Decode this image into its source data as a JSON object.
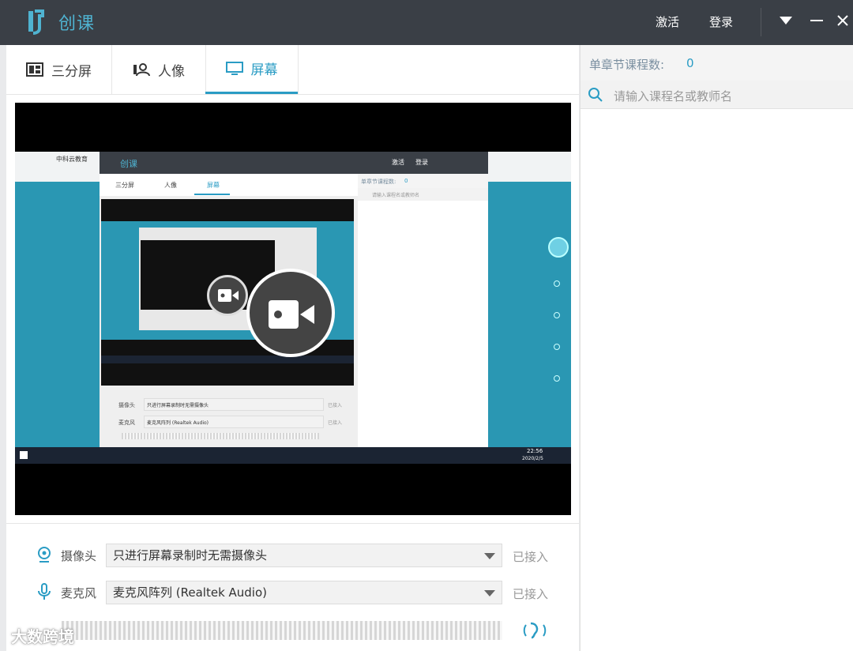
{
  "app": {
    "name": "创课"
  },
  "titlebar": {
    "activate": "激活",
    "login": "登录"
  },
  "tabs": [
    {
      "label": "三分屏",
      "icon": "layout-icon"
    },
    {
      "label": "人像",
      "icon": "portrait-icon"
    },
    {
      "label": "屏幕",
      "icon": "monitor-icon",
      "active": true
    }
  ],
  "devices": {
    "camera": {
      "label": "摄像头",
      "value": "只进行屏幕录制时无需摄像头",
      "status": "已接入"
    },
    "mic": {
      "label": "麦克风",
      "value": "麦克风阵列 (Realtek Audio)",
      "status": "已接入"
    }
  },
  "course_panel": {
    "count_label": "单章节课程数:",
    "count_value": "0",
    "search_placeholder": "请输入课程名或教师名"
  },
  "mini": {
    "app_name": "创课",
    "activate": "激活",
    "login": "登录",
    "tab1": "三分屏",
    "tab2": "人像",
    "tab3": "屏幕",
    "count_label": "单章节课程数:",
    "count_value": "0",
    "search": "请输入课程名或教师名",
    "cam_label": "摄像头",
    "cam_value": "只进行屏幕录制时无需摄像头",
    "mic_label": "麦克风",
    "mic_value": "麦克风阵列 (Realtek Audio)",
    "status": "已接入",
    "browser_tab": "中科云教育",
    "time": "22:56",
    "date": "2020/2/5"
  },
  "watermark": "大数跨境",
  "colors": {
    "accent": "#2a9cc4",
    "titlebar": "#3a3f46",
    "logo": "#4fb3d1"
  }
}
